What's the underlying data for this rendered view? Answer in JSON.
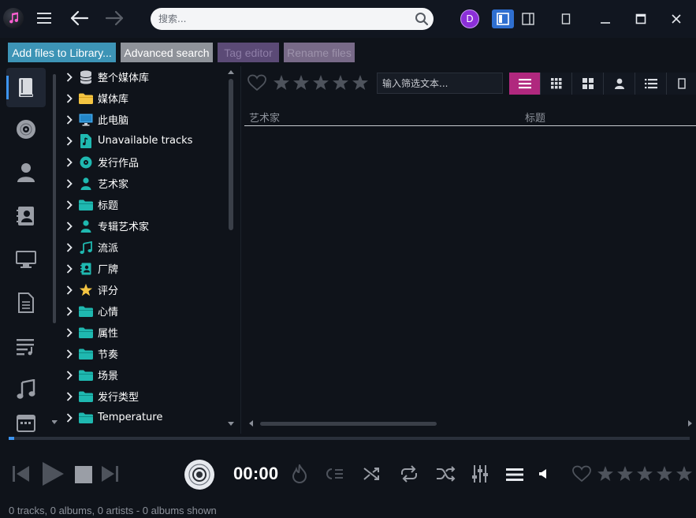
{
  "titlebar": {
    "search_placeholder": "搜索..."
  },
  "user": {
    "initial": "D"
  },
  "toolbar": {
    "add_files": "Add files to Library...",
    "advanced_search": "Advanced search",
    "tag_editor": "Tag editor",
    "rename_files": "Rename files"
  },
  "tree": {
    "items": [
      {
        "label": "整个媒体库",
        "icon": "database-icon"
      },
      {
        "label": "媒体库",
        "icon": "folder-icon"
      },
      {
        "label": "此电脑",
        "icon": "monitor-icon"
      },
      {
        "label": "Unavailable tracks",
        "icon": "music-file-icon"
      },
      {
        "label": "发行作品",
        "icon": "disc-icon"
      },
      {
        "label": "艺术家",
        "icon": "person-icon"
      },
      {
        "label": "标题",
        "icon": "folder-icon"
      },
      {
        "label": "专辑艺术家",
        "icon": "person-icon"
      },
      {
        "label": "流派",
        "icon": "music-note-icon"
      },
      {
        "label": "厂牌",
        "icon": "contact-book-icon"
      },
      {
        "label": "评分",
        "icon": "star-icon"
      },
      {
        "label": "心情",
        "icon": "folder-icon"
      },
      {
        "label": "属性",
        "icon": "folder-icon"
      },
      {
        "label": "节奏",
        "icon": "folder-icon"
      },
      {
        "label": "场景",
        "icon": "folder-icon"
      },
      {
        "label": "发行类型",
        "icon": "folder-icon"
      },
      {
        "label": "Temperature",
        "icon": "folder-icon"
      }
    ]
  },
  "main": {
    "filter_placeholder": "输入筛选文本...",
    "columns": [
      "艺术家",
      "标题"
    ]
  },
  "player": {
    "time": "00:00",
    "progress": 0.008
  },
  "status": {
    "text": "0 tracks, 0 albums, 0 artists - 0 albums shown"
  },
  "colors": {
    "accent": "#3d94f0",
    "view_active": "#b0287e",
    "folder_teal": "#1fb8b0",
    "folder_yellow": "#f5c542"
  }
}
